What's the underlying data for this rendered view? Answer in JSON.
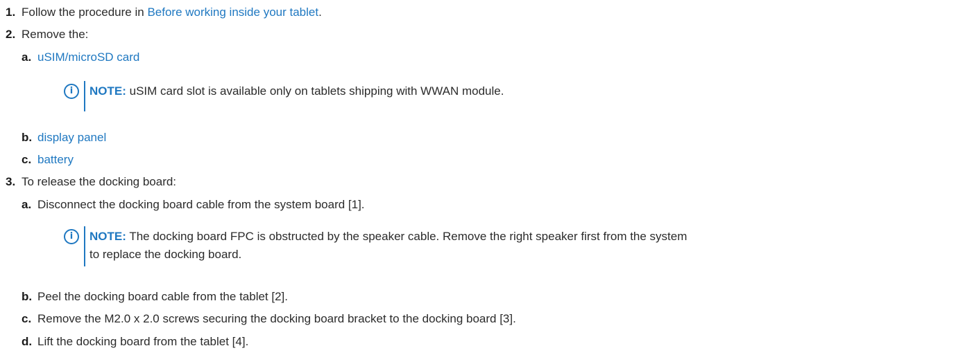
{
  "steps": [
    {
      "num": "1.",
      "text_before": "Follow the procedure in ",
      "link": "Before working inside your tablet",
      "text_after": "."
    },
    {
      "num": "2.",
      "text": "Remove the:",
      "substeps": [
        {
          "num": "a.",
          "link": "uSIM/microSD card",
          "note": {
            "label": "NOTE:",
            "text": "uSIM card slot is available only on tablets shipping with WWAN module."
          }
        },
        {
          "num": "b.",
          "link": "display panel"
        },
        {
          "num": "c.",
          "link": "battery"
        }
      ]
    },
    {
      "num": "3.",
      "text": "To release the docking board:",
      "substeps": [
        {
          "num": "a.",
          "text": "Disconnect the docking board cable from the system board [1].",
          "note": {
            "label": "NOTE:",
            "line1": "The docking board FPC is obstructed by the speaker cable. Remove the right speaker first from the system",
            "line2": "to replace the docking board."
          }
        },
        {
          "num": "b.",
          "text": "Peel the docking board cable from the tablet [2]."
        },
        {
          "num": "c.",
          "text": "Remove the M2.0 x 2.0 screws securing the docking board bracket to the docking board [3]."
        },
        {
          "num": "d.",
          "text": "Lift the docking board from the tablet [4]."
        }
      ]
    }
  ],
  "icons": {
    "note_icon": "info-circle-icon",
    "note_glyph": "i"
  },
  "colors": {
    "link": "#1f78c1",
    "text": "#2b2b2b"
  }
}
